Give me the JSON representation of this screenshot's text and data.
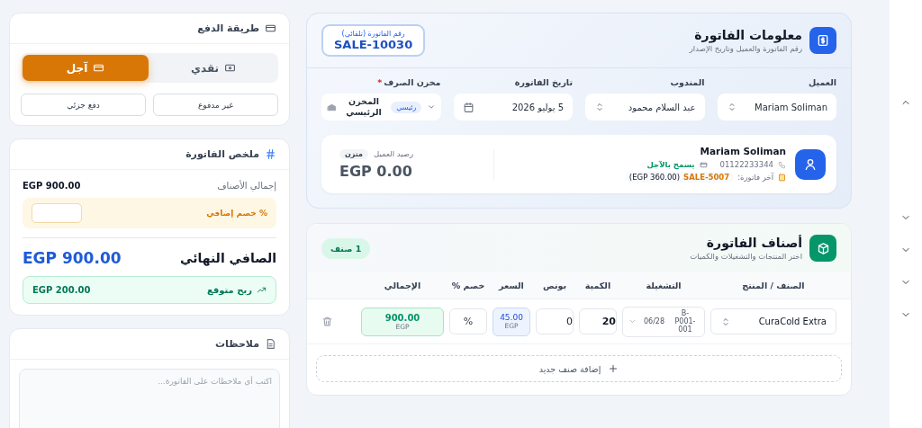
{
  "payment_method": {
    "title": "طريقة الدفع",
    "methods": [
      {
        "label": "نقدي",
        "kind": "cash",
        "selected": false
      },
      {
        "label": "آجل",
        "kind": "credit",
        "selected": true
      }
    ],
    "options": [
      {
        "label": "غير مدفوع",
        "selected": false
      },
      {
        "label": "دفع جزئي",
        "selected": false
      }
    ]
  },
  "summary": {
    "title": "ملخص الفاتورة",
    "items_total_label": "إجمالي الأصناف",
    "items_total": "EGP 900.00",
    "extra_discount_label": "% خصم إضافي",
    "net_label": "الصافي النهائي",
    "net": "EGP 900.00",
    "profit_label": "ربح متوقع",
    "profit": "EGP 200.00"
  },
  "notes": {
    "title": "ملاحظات",
    "placeholder": "اكتب أي ملاحظات على الفاتورة..."
  },
  "invoice_info": {
    "title": "معلومات الفاتورة",
    "subtitle": "رقم الفاتورة والعميل وتاريخ الإصدار",
    "number_label": "رقم الفاتورة (تلقائي)",
    "number": "SALE-10030",
    "required_mark": "*",
    "fields": [
      {
        "label": "العميل",
        "value": "Mariam Soliman",
        "kind": "select",
        "required": false
      },
      {
        "label": "المندوب",
        "value": "عبد السلام محمود",
        "kind": "select",
        "required": false
      },
      {
        "label": "تاريخ الفاتورة",
        "value": "5 يوليو 2026",
        "kind": "date",
        "required": false
      },
      {
        "label": "مخزن الصرف",
        "value": "المخزن الرئيسي",
        "badge": "رئيسي",
        "kind": "warehouse",
        "required": true
      }
    ],
    "customer": {
      "name": "Mariam Soliman",
      "phone": "01122233344",
      "credit": "يسمح بالآجل",
      "last_invoice_label": "آخر فاتورة:",
      "last_invoice": "SALE-5007",
      "last_invoice_amount": "(EGP 360.00)",
      "balance_label": "رصيد العميل",
      "balance_status": "متزن",
      "balance": "EGP 0.00"
    }
  },
  "items": {
    "title": "أصناف الفاتورة",
    "subtitle": "اختر المنتجات والتشغيلات والكميات",
    "count": "1 صنف",
    "columns": [
      "الصنف / المنتج",
      "التشغيلة",
      "الكمية",
      "بونص",
      "السعر",
      "خصم %",
      "الإجمالي"
    ],
    "rows": [
      {
        "product": "CuraCold Extra",
        "batch": "B-P001-001",
        "expiry": "06/28",
        "quantity": "20",
        "bonus": "0",
        "price": "45.00",
        "price_currency": "EGP",
        "discount_placeholder": "%",
        "total": "900.00",
        "total_currency": "EGP"
      }
    ],
    "add_label": "إضافة صنف جديد"
  },
  "sidebar": {
    "sections": [
      {
        "expanded": true
      },
      {
        "expanded": false
      },
      {
        "expanded": false
      },
      {
        "expanded": false
      },
      {
        "expanded": false
      }
    ]
  }
}
